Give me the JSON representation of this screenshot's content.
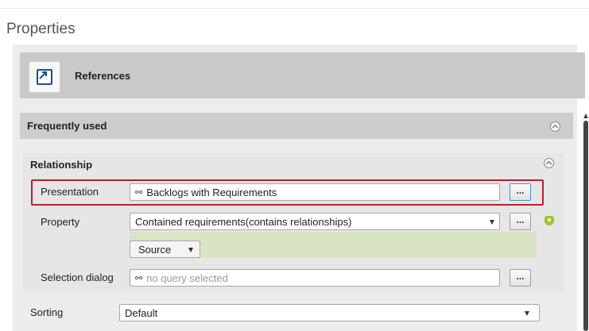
{
  "page": {
    "title": "Properties"
  },
  "references": {
    "label": "References",
    "icon": "references-arrow-icon"
  },
  "frequently_used": {
    "label": "Frequently used"
  },
  "relationship": {
    "label": "Relationship",
    "presentation": {
      "label": "Presentation",
      "value": "Backlogs with Requirements",
      "button": "..."
    },
    "property": {
      "label": "Property",
      "value": "Contained requirements(contains relationships)",
      "button": "..."
    },
    "source": {
      "value": "Source"
    },
    "selection_dialog": {
      "label": "Selection dialog",
      "placeholder": "no query selected",
      "button": "..."
    }
  },
  "sorting": {
    "label": "Sorting",
    "value": "Default"
  },
  "colors": {
    "highlight": "#b8222a",
    "accent_green": "#a2c232",
    "source_area": "#d8e4c4"
  }
}
